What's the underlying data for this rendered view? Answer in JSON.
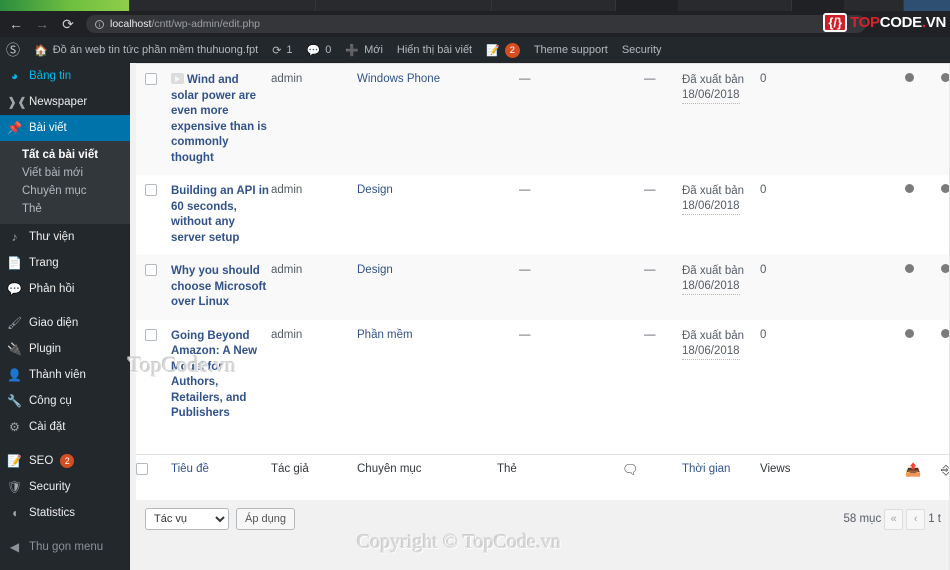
{
  "browser": {
    "back_icon": "←",
    "forward_icon": "→",
    "reload_icon": "⟳",
    "info_icon": "i",
    "url_host": "localhost",
    "url_path": "/cntt/wp-admin/edit.php"
  },
  "logo": {
    "badge": "{/}",
    "part1": "TOP",
    "part2": "CODE",
    "part3": ".",
    "part4": "VN"
  },
  "adminbar": {
    "wp_icon": "wp-logo-icon",
    "home_icon": "home-icon",
    "site_title": "Đồ án web tin tức phần mềm thuhuong.fpt",
    "updates_count": "1",
    "comments_count": "0",
    "new_label": "Mới",
    "view_posts_label": "Hiển thị bài viết",
    "seo_badge": "2",
    "theme_support_label": "Theme support",
    "security_label": "Security"
  },
  "sidebar": {
    "items": [
      {
        "label": "Bảng tin",
        "icon": "dashboard-icon"
      },
      {
        "label": "Newspaper",
        "icon": "newspaper-icon"
      },
      {
        "label": "Bài viết",
        "icon": "pin-icon"
      },
      {
        "label": "Thư viện",
        "icon": "media-icon"
      },
      {
        "label": "Trang",
        "icon": "page-icon"
      },
      {
        "label": "Phản hồi",
        "icon": "comment-icon"
      },
      {
        "label": "Giao diện",
        "icon": "appearance-icon"
      },
      {
        "label": "Plugin",
        "icon": "plugin-icon"
      },
      {
        "label": "Thành viên",
        "icon": "users-icon"
      },
      {
        "label": "Công cụ",
        "icon": "tools-icon"
      },
      {
        "label": "Cài đặt",
        "icon": "settings-icon"
      },
      {
        "label": "SEO",
        "icon": "seo-icon",
        "badge": "2"
      },
      {
        "label": "Security",
        "icon": "shield-icon"
      },
      {
        "label": "Statistics",
        "icon": "statistics-icon"
      },
      {
        "label": "Thu gọn menu",
        "icon": "collapse-icon"
      }
    ],
    "submenu": [
      "Tất cả bài viết",
      "Viết bài mới",
      "Chuyên mục",
      "Thẻ"
    ]
  },
  "table": {
    "columns": {
      "title": "Tiêu đề",
      "author": "Tác giả",
      "category": "Chuyên mục",
      "tags": "Thẻ",
      "comments_icon": "comment-icon",
      "date": "Thời gian",
      "views": "Views",
      "icon1": "duplicate-post-icon",
      "icon2": "order-icon"
    },
    "rows": [
      {
        "format_icon": "video-format-icon",
        "title": "Wind and solar power are even more expensive than is commonly thought",
        "author": "admin",
        "category": "Windows Phone",
        "tags": "—",
        "comments": "—",
        "status": "Đã xuất bản",
        "date": "18/06/2018",
        "views": "0"
      },
      {
        "format_icon": "",
        "title": "Building an API in 60 seconds, without any server setup",
        "author": "admin",
        "category": "Design",
        "tags": "—",
        "comments": "—",
        "status": "Đã xuất bản",
        "date": "18/06/2018",
        "views": "0"
      },
      {
        "format_icon": "",
        "title": "Why you should choose Microsoft over Linux",
        "author": "admin",
        "category": "Design",
        "tags": "—",
        "comments": "—",
        "status": "Đã xuất bản",
        "date": "18/06/2018",
        "views": "0"
      },
      {
        "format_icon": "",
        "title": "Going Beyond Amazon: A New Model for Authors, Retailers, and Publishers",
        "author": "admin",
        "category": "Phần mềm",
        "tags": "—",
        "comments": "—",
        "status": "Đã xuất bản",
        "date": "18/06/2018",
        "views": "0"
      }
    ]
  },
  "bottom": {
    "bulk_select_value": "Tác vụ",
    "apply_label": "Áp dụng",
    "total_items": "58 mục",
    "first_page_icon": "«",
    "prev_page_icon": "‹",
    "page_text": "1 t"
  },
  "watermarks": {
    "center": "TopCode.vn",
    "copyright": "Copyright © TopCode.vn"
  },
  "colors": {
    "admin_bg": "#23282d",
    "accent": "#0073aa",
    "link": "#32528c",
    "badge": "#d54e21",
    "logo_red": "#d8232a"
  }
}
